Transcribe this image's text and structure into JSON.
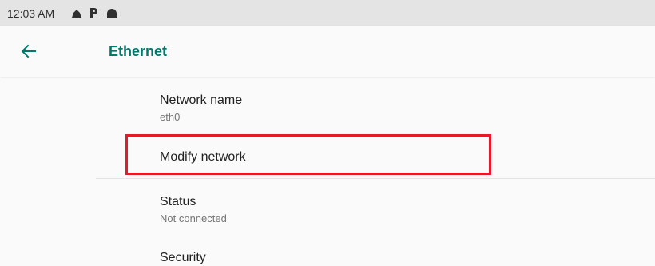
{
  "status_bar": {
    "time": "12:03 AM",
    "icons": [
      "cloud-icon",
      "parking-icon",
      "android-icon"
    ]
  },
  "app_bar": {
    "back_icon": "arrow-back-icon",
    "title": "Ethernet"
  },
  "preferences": [
    {
      "title": "Network name",
      "summary": "eth0"
    },
    {
      "title": "Modify network",
      "summary": ""
    },
    {
      "title": "Status",
      "summary": "Not connected"
    },
    {
      "title": "Security",
      "summary": ""
    }
  ],
  "colors": {
    "accent": "#00796b",
    "highlight": "#e21a2c",
    "status_bar_bg": "#e4e4e4",
    "background": "#fafafa"
  }
}
